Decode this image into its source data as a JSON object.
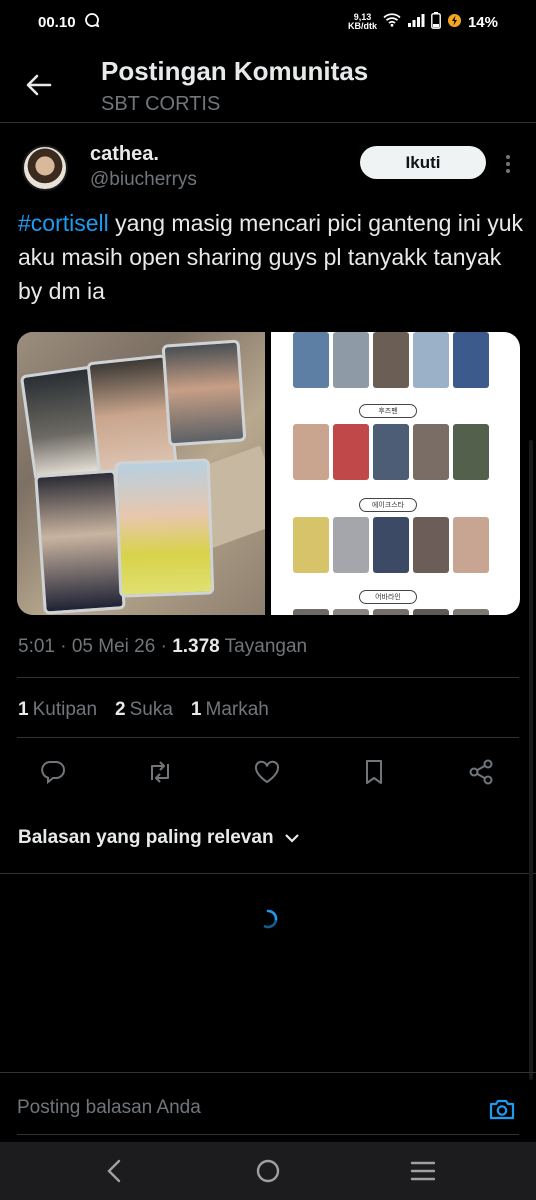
{
  "status_bar": {
    "time": "00.10",
    "net_speed_value": "9,13",
    "net_speed_unit": "KB/dtk",
    "battery": "14%"
  },
  "header": {
    "title": "Postingan Komunitas",
    "subtitle": "SBT CORTIS"
  },
  "post": {
    "author_name": "cathea.",
    "author_handle": "@biucherrys",
    "follow_label": "Ikuti",
    "hashtag": "#cortisell",
    "text_after_hashtag": " yang masig mencari pici ganteng ini yuk aku masih open sharing guys pl tanyakk tanyak by dm ia",
    "time_date": "5:01 · 05 Mei 26 · ",
    "views_count": "1.378",
    "views_label": " Tayangan",
    "quotes_count": "1",
    "quotes_label": "Kutipan",
    "likes_count": "2",
    "likes_label": "Suka",
    "bookmarks_count": "1",
    "bookmarks_label": "Markah"
  },
  "media": {
    "labels": [
      "후즈펜",
      "에이크스타",
      "어바라인"
    ]
  },
  "replies": {
    "sort_label": "Balasan yang paling relevan",
    "placeholder": "Posting balasan Anda"
  },
  "colors": {
    "accent": "#1d9bf0",
    "background": "#000000",
    "muted": "#71767b",
    "text": "#e7e9ea"
  }
}
